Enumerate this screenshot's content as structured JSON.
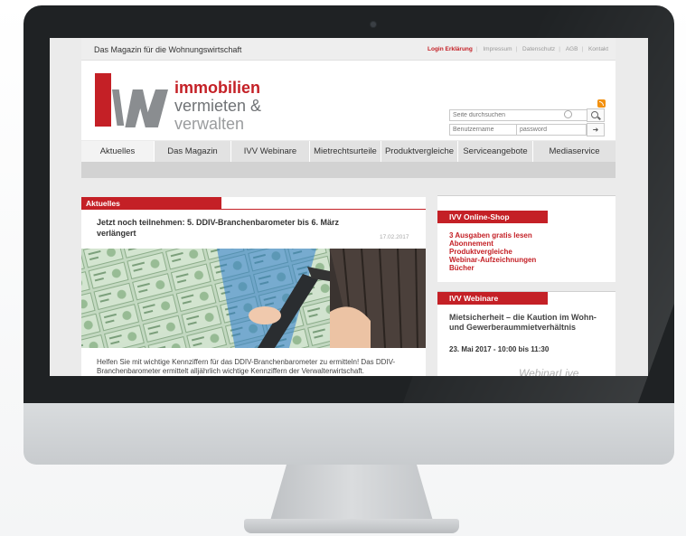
{
  "site": {
    "tagline": "Das Magazin für die Wohnungswirtschaft",
    "toplinks": [
      "Login Erklärung",
      "Impressum",
      "Datenschutz",
      "AGB",
      "Kontakt"
    ],
    "brand": [
      "immobilien",
      "vermieten &",
      "verwalten"
    ],
    "logo_letters": "iVW"
  },
  "search": {
    "placeholder": "Seite durchsuchen",
    "username_placeholder": "Benutzername",
    "password_placeholder": "password"
  },
  "nav": {
    "items": [
      "Aktuelles",
      "Das Magazin",
      "IVV Webinare",
      "Mietrechtsurteile",
      "Produktvergleiche",
      "Serviceangebote",
      "Mediaservice"
    ],
    "active": "Aktuelles"
  },
  "main": {
    "section": "Aktuelles",
    "article_title": "Jetzt noch teilnehmen: 5. DDIV-Branchenbarometer bis 6. März verlängert",
    "article_date": "17.02.2017",
    "article_text": "Helfen Sie mit wichtige Kennziffern für das DDIV-Branchenbarometer zu ermitteln! Das DDIV-Branchenbarometer ermittelt alljährlich wichtige Kennziffern der Verwalterwirtschaft."
  },
  "sidebar": {
    "shop_title": "IVV Online-Shop",
    "shop_links": [
      "3 Ausgaben gratis lesen",
      "Abonnement",
      "Produktvergleiche",
      "Webinar-Aufzeichnungen",
      "Bücher"
    ],
    "webinar_title": "IVV Webinare",
    "webinar_subject": "Mietsicherheit – die Kaution im Wohn- und Gewerberaummietverhältnis",
    "webinar_date": "23. Mai 2017 - 10:00 bis 11:30",
    "webinar_provider": "WebinarLive"
  },
  "colors": {
    "accent": "#c42026",
    "logo_grey": "#8a8d90",
    "rss": "#f29111"
  },
  "icons": [
    "rss-icon",
    "search-icon",
    "login-icon",
    "clear-icon"
  ]
}
